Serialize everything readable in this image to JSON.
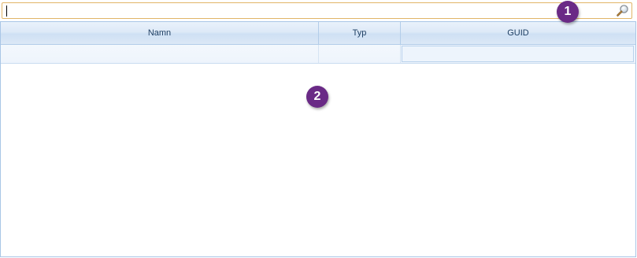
{
  "search": {
    "value": "",
    "placeholder": "",
    "icon": "magnifier-icon"
  },
  "grid": {
    "columns": [
      {
        "label": "Namn"
      },
      {
        "label": "Typ"
      },
      {
        "label": "GUID"
      }
    ],
    "filters": {
      "name": "",
      "type": "",
      "guid": ""
    },
    "rows": []
  },
  "callouts": {
    "one": "1",
    "two": "2"
  },
  "colors": {
    "accent": "#6a2a86",
    "search_border": "#e1b567",
    "grid_border": "#a9c6e6"
  }
}
